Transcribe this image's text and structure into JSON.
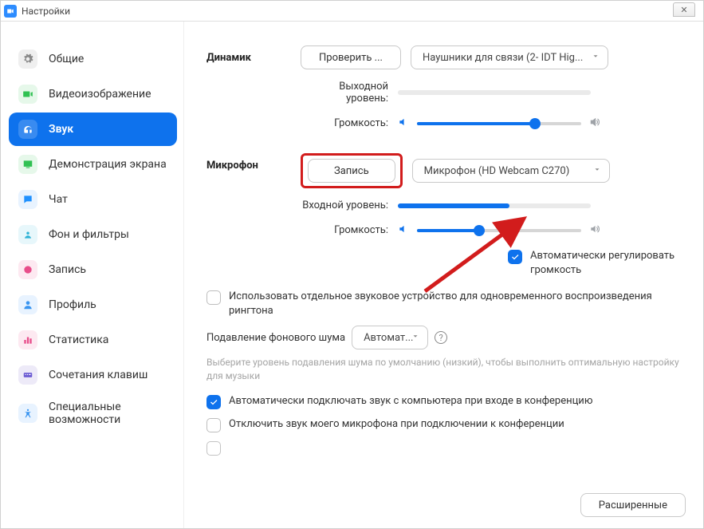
{
  "titlebar": {
    "title": "Настройки",
    "close": "✕"
  },
  "sidebar": {
    "items": [
      {
        "label": "Общие"
      },
      {
        "label": "Видеоизображение"
      },
      {
        "label": "Звук"
      },
      {
        "label": "Демонстрация экрана"
      },
      {
        "label": "Чат"
      },
      {
        "label": "Фон и фильтры"
      },
      {
        "label": "Запись"
      },
      {
        "label": "Профиль"
      },
      {
        "label": "Статистика"
      },
      {
        "label": "Сочетания клавиш"
      },
      {
        "label": "Специальные возможности"
      }
    ]
  },
  "speaker": {
    "section": "Динамик",
    "test_btn": "Проверить ...",
    "device": "Наушники для связи (2- IDT Hig...",
    "output_label": "Выходной уровень:",
    "output_level_pct": 0,
    "volume_label": "Громкость:",
    "volume_pct": 72
  },
  "mic": {
    "section": "Микрофон",
    "record_btn": "Запись",
    "device": "Микрофон (HD Webcam C270)",
    "input_label": "Входной уровень:",
    "input_level_pct": 58,
    "volume_label": "Громкость:",
    "volume_pct": 38,
    "auto_adjust": "Автоматически регулировать громкость"
  },
  "options": {
    "ringtone_device": "Использовать отдельное звуковое устройство для одновременного воспроизведения рингтона",
    "suppress_label": "Подавление фонового шума",
    "suppress_value": "Автомат...",
    "suppress_hint": "Выберите уровень подавления шума по умолчанию (низкий), чтобы выполнить оптимальную настройку для музыки",
    "auto_join_audio": "Автоматически подключать звук с компьютера при входе в конференцию",
    "mute_on_join": "Отключить звук моего микрофона при подключении к конференции"
  },
  "footer": {
    "advanced": "Расширенные"
  }
}
